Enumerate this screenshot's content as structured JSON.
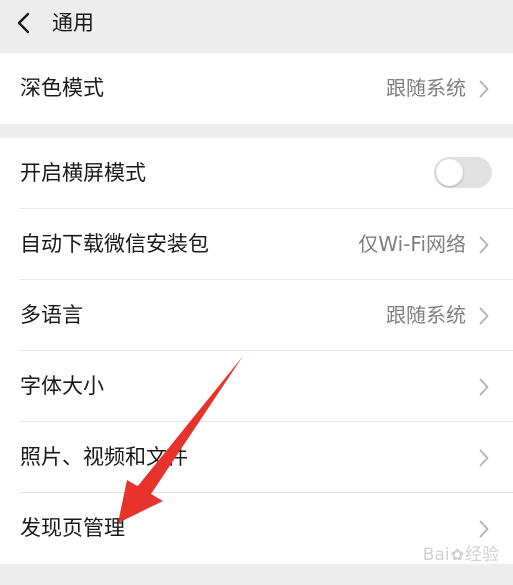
{
  "header": {
    "title": "通用",
    "back_icon": "chevron-left-icon"
  },
  "group1": {
    "dark_mode": {
      "label": "深色模式",
      "value": "跟随系统"
    }
  },
  "group2": {
    "landscape": {
      "label": "开启横屏模式",
      "enabled": false
    },
    "auto_download": {
      "label": "自动下载微信安装包",
      "value": "仅Wi-Fi网络"
    },
    "language": {
      "label": "多语言",
      "value": "跟随系统"
    },
    "font_size": {
      "label": "字体大小"
    },
    "photos_videos_files": {
      "label": "照片、视频和文件"
    },
    "discover_management": {
      "label": "发现页管理"
    }
  },
  "overlay": {
    "watermark_text_before": "Bai",
    "watermark_text_after": "经验",
    "annotation_arrow_color": "#e8322c"
  },
  "colors": {
    "background": "#ededed",
    "row_background": "#ffffff",
    "primary_text": "#191919",
    "secondary_text": "#7f7f7f",
    "toggle_off": "#e1e1e1"
  }
}
